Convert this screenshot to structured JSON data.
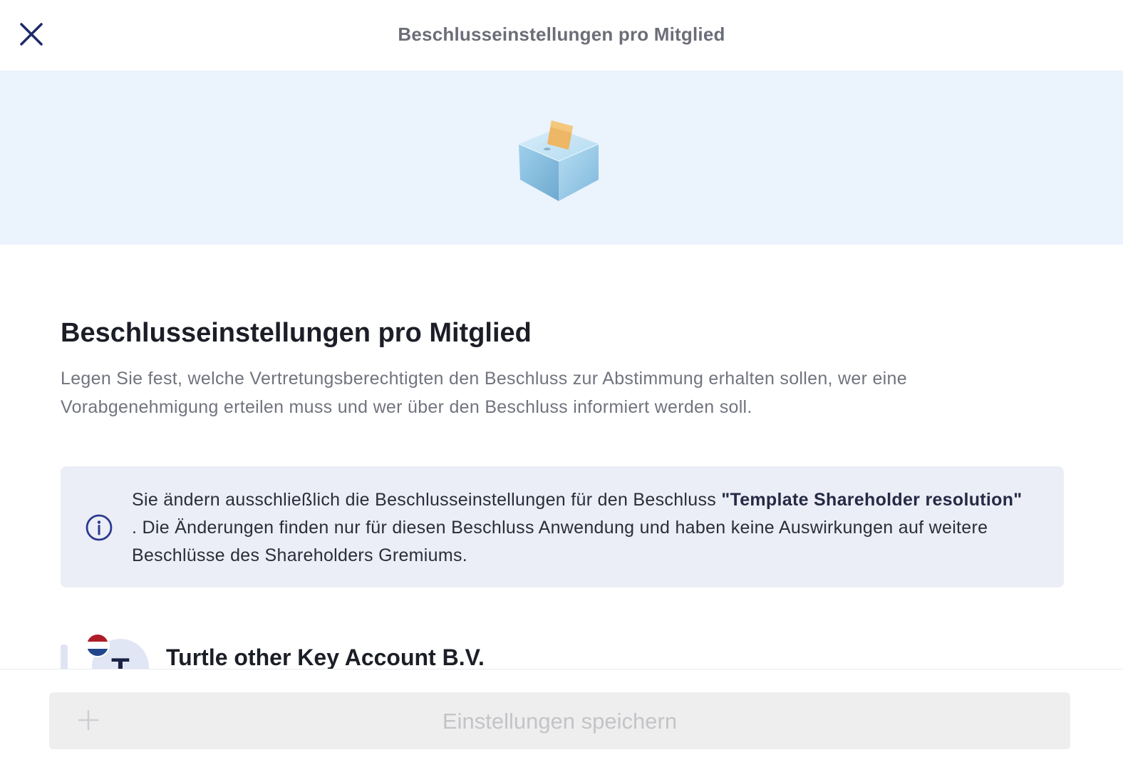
{
  "topbar": {
    "title": "Beschlusseinstellungen pro Mitglied",
    "close_icon": "close-icon"
  },
  "hero": {
    "illustration": "ballot-box-icon"
  },
  "main": {
    "heading": "Beschlusseinstellungen pro Mitglied",
    "description": "Legen Sie fest, welche Vertretungsberechtigten den Beschluss zur Abstimmung erhalten sollen, wer eine Vorabgenehmigung erteilen muss und wer über den Beschluss informiert werden soll."
  },
  "notice": {
    "icon": "info-icon",
    "text_before": "Sie ändern ausschließlich die Beschlusseinstellungen für den Beschluss ",
    "resolution_name": "\"Template Shareholder resolution\"",
    "text_after": " . Die Änderungen finden nur für diesen Beschluss Anwendung und haben keine Auswirkungen auf weitere Beschlüsse des Shareholders Gremiums."
  },
  "member": {
    "name": "Turtle other Key Account B.V.",
    "avatar_letter": "T",
    "flag": "netherlands-flag-icon"
  },
  "footer": {
    "save_label": "Einstellungen speichern",
    "save_icon": "plus-icon",
    "save_enabled": false
  },
  "colors": {
    "accent": "#1c2a6b",
    "hero_background": "#ebf3fd",
    "notice_background": "#ebeef6",
    "button_disabled_background": "#eeeeee",
    "button_disabled_text": "#c4c4c8"
  }
}
